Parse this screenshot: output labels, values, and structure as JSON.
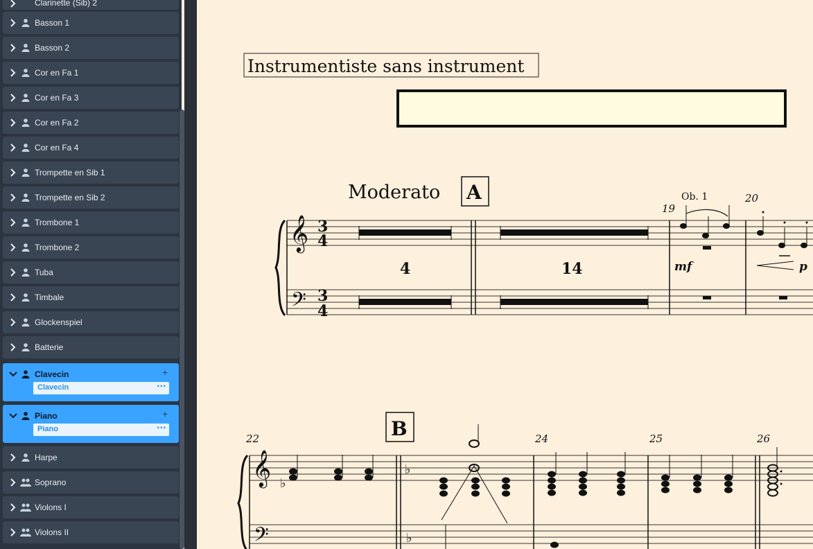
{
  "sidebar": {
    "partial_top": "Clarinette (Sib) 2",
    "instruments": [
      {
        "label": "Basson 1",
        "icon": "person-icon"
      },
      {
        "label": "Basson 2",
        "icon": "person-icon"
      },
      {
        "label": "Cor en Fa 1",
        "icon": "person-icon"
      },
      {
        "label": "Cor en Fa 3",
        "icon": "person-icon"
      },
      {
        "label": "Cor en Fa 2",
        "icon": "person-icon"
      },
      {
        "label": "Cor en Fa 4",
        "icon": "person-icon"
      },
      {
        "label": "Trompette en Sib 1",
        "icon": "person-icon"
      },
      {
        "label": "Trompette en Sib 2",
        "icon": "person-icon"
      },
      {
        "label": "Trombone 1",
        "icon": "person-icon"
      },
      {
        "label": "Trombone 2",
        "icon": "person-icon"
      },
      {
        "label": "Tuba",
        "icon": "person-icon"
      },
      {
        "label": "Timbale",
        "icon": "person-icon"
      },
      {
        "label": "Glockenspiel",
        "icon": "person-icon"
      },
      {
        "label": "Batterie",
        "icon": "person-icon"
      }
    ],
    "expanded": [
      {
        "label": "Clavecin",
        "sub": "Clavecin",
        "plus": "+",
        "dots": "···"
      },
      {
        "label": "Piano",
        "sub": "Piano",
        "plus": "+",
        "dots": "···"
      }
    ],
    "instruments_after": [
      {
        "label": "Harpe",
        "icon": "person-icon"
      },
      {
        "label": "Soprano",
        "icon": "group-icon"
      },
      {
        "label": "Violons I",
        "icon": "group-icon"
      },
      {
        "label": "Violons II",
        "icon": "group-icon"
      }
    ]
  },
  "score": {
    "title": "Instrumentiste sans instrument",
    "tempo": "Moderato",
    "rehearsal_a": "A",
    "rehearsal_b": "B",
    "time_sig_num": "3",
    "time_sig_den": "4",
    "multirest_1": "4",
    "multirest_2": "14",
    "instrument_cue": "Ob. 1",
    "bar_19": "19",
    "bar_20": "20",
    "dyn_mf": "mf",
    "dyn_p": "p",
    "bar_22": "22",
    "bar_24": "24",
    "bar_25": "25",
    "bar_26": "26"
  },
  "colors": {
    "sidebar_bg": "#2c3440",
    "card_bg": "#3a4553",
    "selected": "#3aa3ff",
    "paper": "#fdf0dc"
  }
}
